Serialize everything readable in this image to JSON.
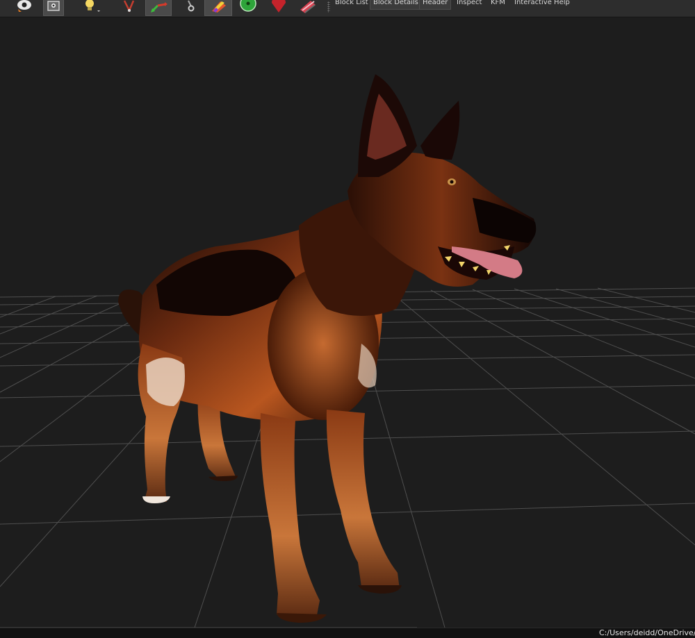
{
  "toolbar": {
    "buttons": [
      {
        "name": "view-icon"
      },
      {
        "name": "camera-icon"
      },
      {
        "name": "light-icon"
      },
      {
        "name": "select-vertex-icon"
      },
      {
        "name": "transform-icon"
      },
      {
        "name": "pin-icon"
      },
      {
        "name": "textures-icon"
      },
      {
        "name": "origin-icon"
      },
      {
        "name": "marker-icon"
      },
      {
        "name": "collision-icon"
      }
    ],
    "menus": [
      {
        "label": "Block List"
      },
      {
        "label": "Block Details"
      },
      {
        "label": "Header"
      },
      {
        "label": "Inspect"
      },
      {
        "label": "KFM"
      },
      {
        "label": "Interactive Help"
      }
    ]
  },
  "status": {
    "path": "C:/Users/deidd/OneDrive/"
  },
  "colors": {
    "toolbar_bg": "#2d2d2d",
    "viewport_bg": "#1d1d1d",
    "grid": "#5a5a5a"
  }
}
